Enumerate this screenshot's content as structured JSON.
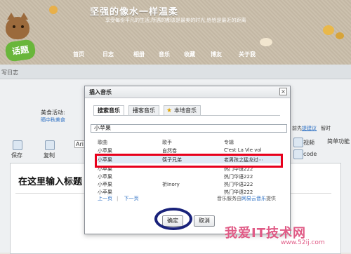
{
  "banner": {
    "title": "坚强的像水一样温柔",
    "subtitle": "享受每份平凡的生活,所遇的都该是最美的时光,恰恰是最近的距离",
    "nav": [
      "首页",
      "日志",
      "相册",
      "音乐",
      "收藏",
      "博友",
      "关于我"
    ]
  },
  "page": {
    "header_title": "写日志",
    "event_label": "美食活动:",
    "event_value": "晒中秋美食",
    "huati": "话题"
  },
  "toolbar": {
    "save": "保存",
    "copy": "复制",
    "font": "Ari",
    "video": "视频",
    "code": "code",
    "simple": "简单功能"
  },
  "right_info": {
    "prefix": "前先",
    "link": "提建议",
    "suffix": "智时"
  },
  "editor": {
    "title_placeholder": "在这里输入标题"
  },
  "dialog": {
    "title": "插入音乐",
    "close": "×",
    "tabs": [
      "搜索音乐",
      "播客音乐",
      "本地音乐"
    ],
    "search_value": "小苹果",
    "columns": [
      "歌曲",
      "歌手",
      "专辑"
    ],
    "rows": [
      {
        "song": "小苹果",
        "artist": "自然卷",
        "album": "C'est La Vie vol"
      },
      {
        "song": "小苹果",
        "artist": "筷子兄弟",
        "album": "老男孩之猛龙过⋯"
      },
      {
        "song": "小苹果",
        "artist": "",
        "album": "热门华语222"
      },
      {
        "song": "小苹果",
        "artist": "",
        "album": "热门华语222"
      },
      {
        "song": "小苹果",
        "artist": "祈Inory",
        "album": "热门华语222"
      },
      {
        "song": "小苹果",
        "artist": "",
        "album": "热门华语222"
      }
    ],
    "pager_prev": "上一页",
    "pager_next": "下一页",
    "provider_prefix": "音乐服务由",
    "provider_link": "网易云音乐",
    "provider_suffix": "提供",
    "ok": "确定",
    "cancel": "取消"
  },
  "watermark": {
    "text": "我爱IT技术网",
    "url": "www.52ij.com"
  },
  "colors": {
    "highlight_red": "#e8001c",
    "oval_blue": "#19227a",
    "watermark_pink": "#e05b86",
    "link_blue": "#2a6ec3"
  }
}
